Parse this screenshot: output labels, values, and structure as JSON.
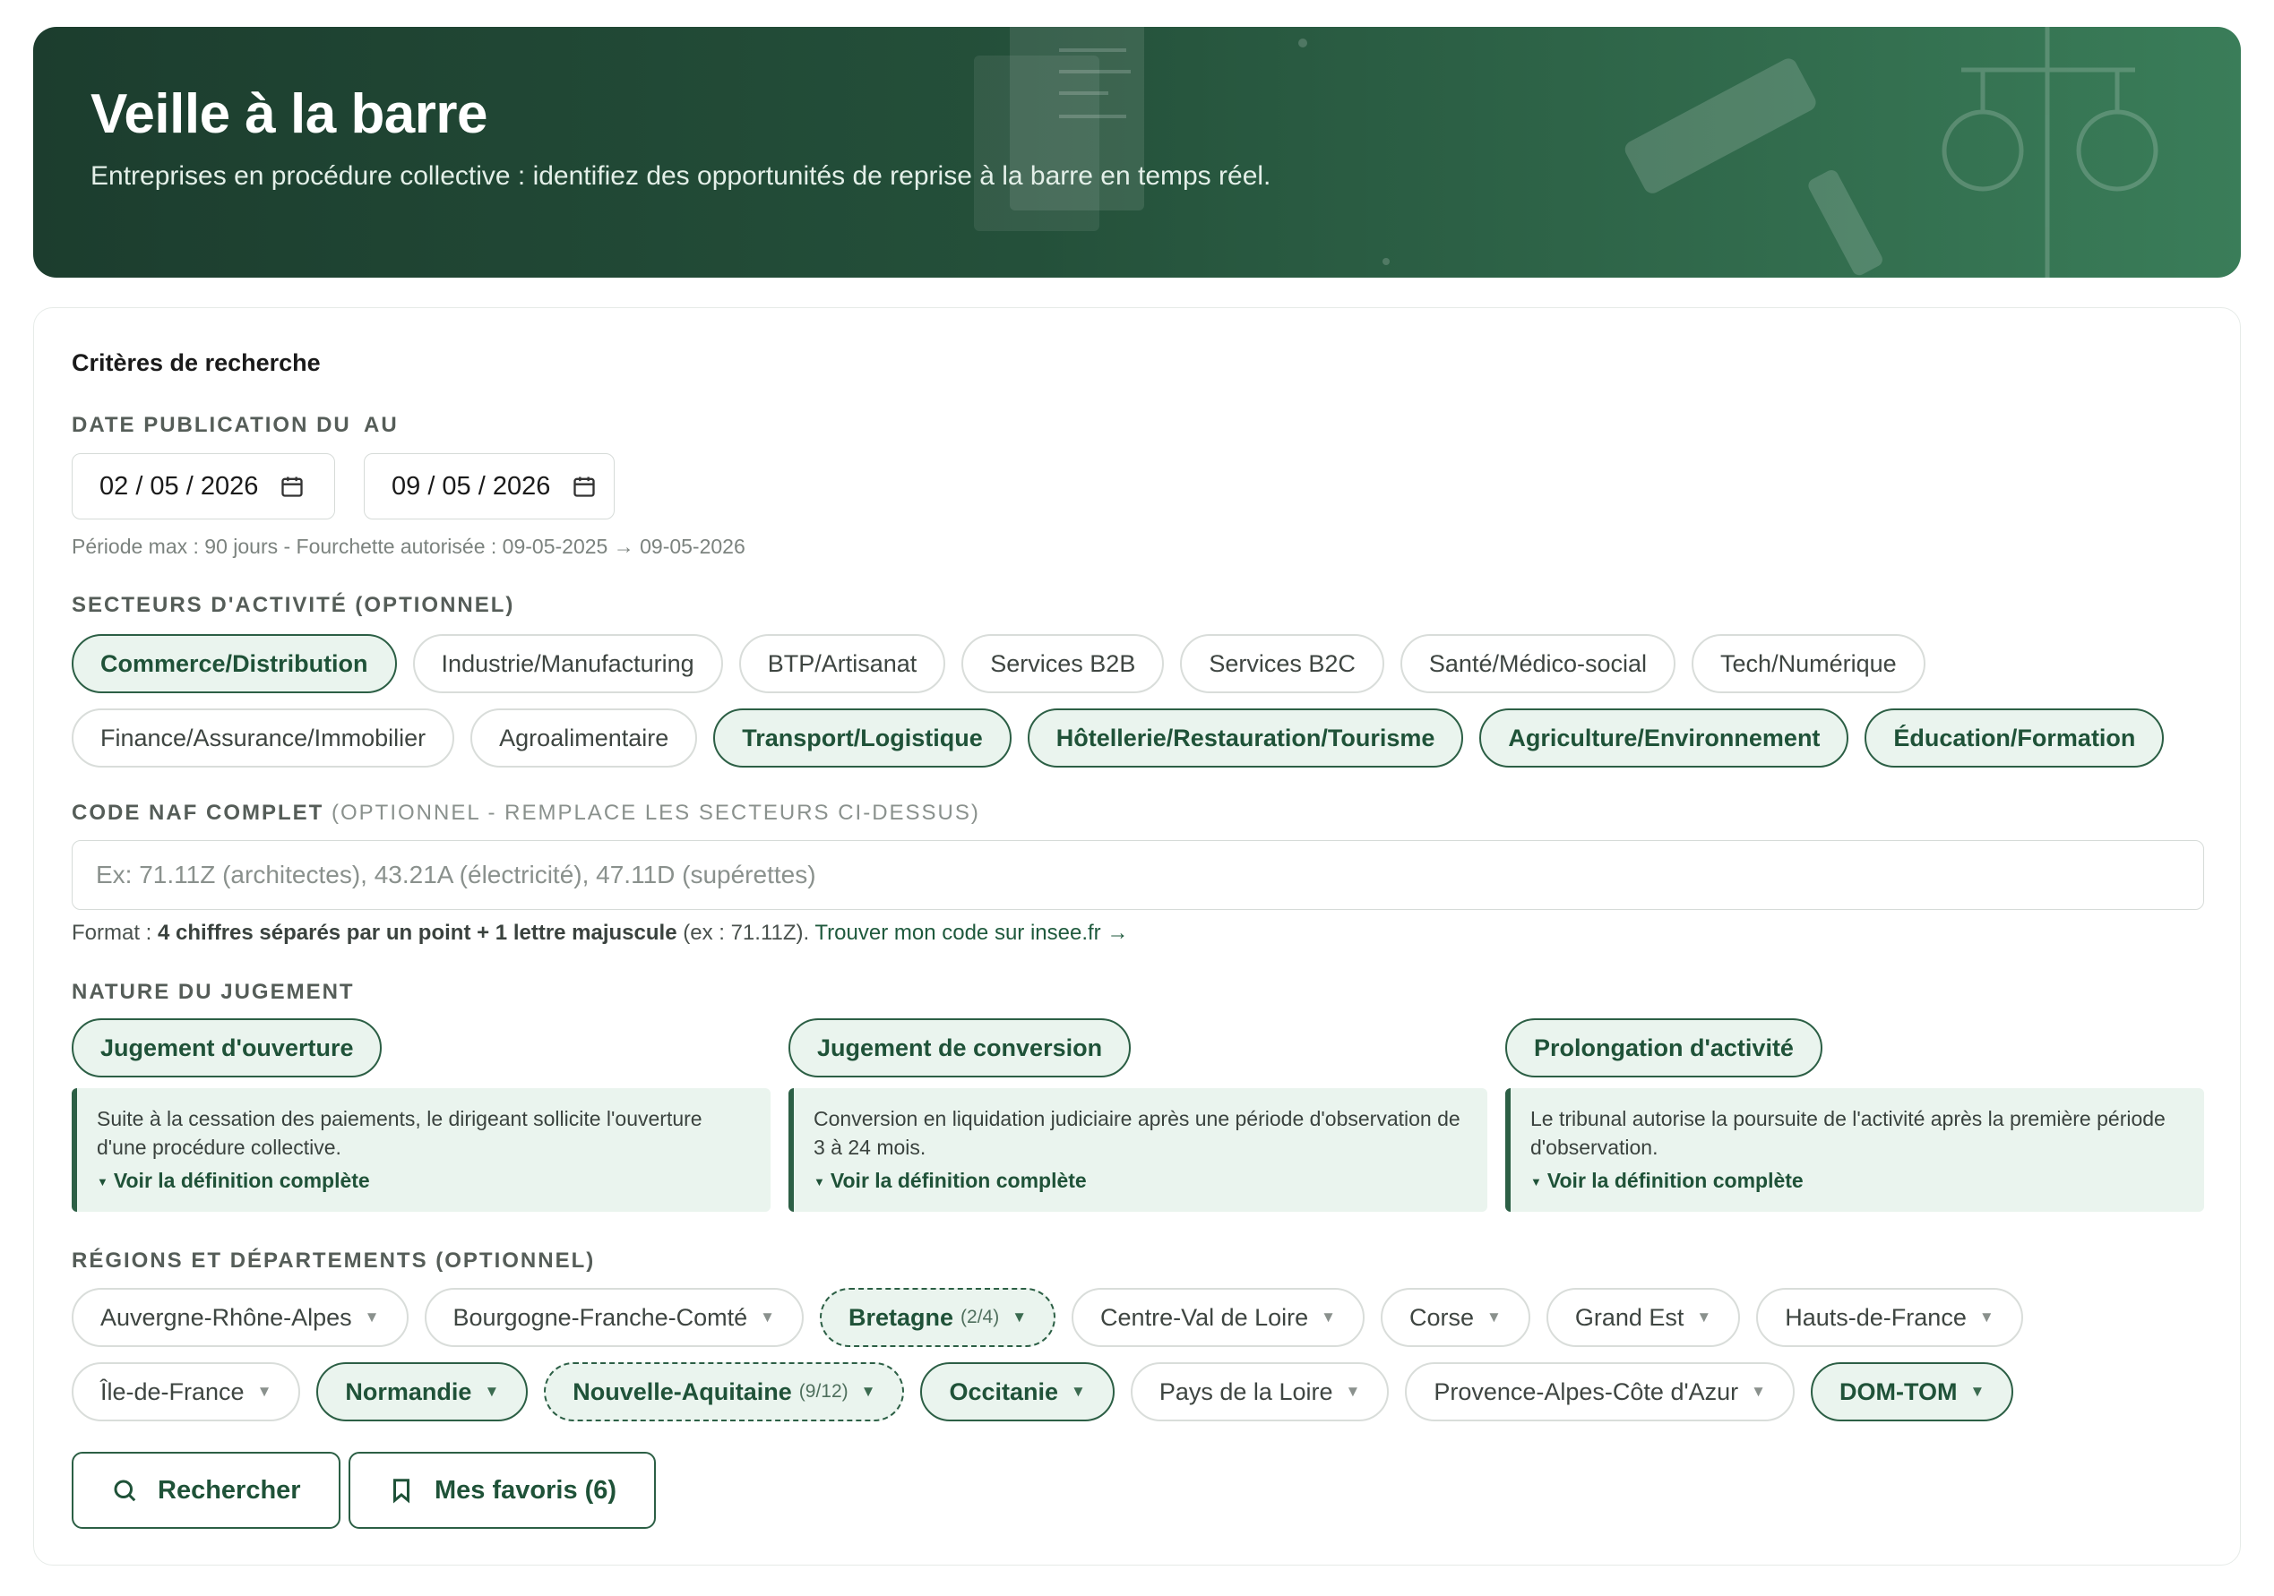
{
  "header": {
    "title": "Veille à la barre",
    "subtitle": "Entreprises en procédure collective : identifiez des opportunités de reprise à la barre en temps réel."
  },
  "search": {
    "section_title": "Critères de recherche",
    "date_from_label": "DATE PUBLICATION DU",
    "date_to_label": "AU",
    "date_from_value": "02 / 05 / 2026",
    "date_to_value": "09 / 05 / 2026",
    "period_hint": "Période max : 90 jours - Fourchette autorisée : 09-05-2025 → 09-05-2026",
    "sectors_label": "SECTEURS D'ACTIVITÉ (OPTIONNEL)",
    "sectors": [
      {
        "label": "Commerce/Distribution",
        "selected": true
      },
      {
        "label": "Industrie/Manufacturing",
        "selected": false
      },
      {
        "label": "BTP/Artisanat",
        "selected": false
      },
      {
        "label": "Services B2B",
        "selected": false
      },
      {
        "label": "Services B2C",
        "selected": false
      },
      {
        "label": "Santé/Médico-social",
        "selected": false
      },
      {
        "label": "Tech/Numérique",
        "selected": false
      },
      {
        "label": "Finance/Assurance/Immobilier",
        "selected": false
      },
      {
        "label": "Agroalimentaire",
        "selected": false
      },
      {
        "label": "Transport/Logistique",
        "selected": true
      },
      {
        "label": "Hôtellerie/Restauration/Tourisme",
        "selected": true
      },
      {
        "label": "Agriculture/Environnement",
        "selected": true
      },
      {
        "label": "Éducation/Formation",
        "selected": true
      }
    ],
    "naf_label": "CODE NAF COMPLET",
    "naf_label_muted": "(OPTIONNEL - REMPLACE LES SECTEURS CI-DESSUS)",
    "naf_placeholder": "Ex: 71.11Z (architectes), 43.21A (électricité), 47.11D (supérettes)",
    "naf_value": "",
    "format_prefix": "Format : ",
    "format_bold": "4 chiffres séparés par un point + 1 lettre majuscule",
    "format_example": " (ex : 71.11Z). ",
    "format_link": "Trouver mon code sur insee.fr →",
    "judgment_label": "NATURE DU JUGEMENT",
    "judgments": [
      {
        "label": "Jugement d'ouverture",
        "desc": "Suite à la cessation des paiements, le dirigeant sollicite l'ouverture d'une procédure collective.",
        "more": "Voir la définition complète"
      },
      {
        "label": "Jugement de conversion",
        "desc": "Conversion en liquidation judiciaire après une période d'observation de 3 à 24 mois.",
        "more": "Voir la définition complète"
      },
      {
        "label": "Prolongation d'activité",
        "desc": "Le tribunal autorise la poursuite de l'activité après la première période d'observation.",
        "more": "Voir la définition complète"
      }
    ],
    "regions_label": "RÉGIONS ET DÉPARTEMENTS (OPTIONNEL)",
    "regions": [
      {
        "label": "Auvergne-Rhône-Alpes",
        "state": "off",
        "count": ""
      },
      {
        "label": "Bourgogne-Franche-Comté",
        "state": "off",
        "count": ""
      },
      {
        "label": "Bretagne",
        "state": "partial",
        "count": "(2/4)"
      },
      {
        "label": "Centre-Val de Loire",
        "state": "off",
        "count": ""
      },
      {
        "label": "Corse",
        "state": "off",
        "count": ""
      },
      {
        "label": "Grand Est",
        "state": "off",
        "count": ""
      },
      {
        "label": "Hauts-de-France",
        "state": "off",
        "count": ""
      },
      {
        "label": "Île-de-France",
        "state": "off",
        "count": ""
      },
      {
        "label": "Normandie",
        "state": "on",
        "count": ""
      },
      {
        "label": "Nouvelle-Aquitaine",
        "state": "partial",
        "count": "(9/12)"
      },
      {
        "label": "Occitanie",
        "state": "on",
        "count": ""
      },
      {
        "label": "Pays de la Loire",
        "state": "off",
        "count": ""
      },
      {
        "label": "Provence-Alpes-Côte d'Azur",
        "state": "off",
        "count": ""
      },
      {
        "label": "DOM-TOM",
        "state": "on",
        "count": ""
      }
    ],
    "search_button": "Rechercher",
    "favorites_button": "Mes favoris (6)"
  },
  "colors": {
    "accent": "#2c5f45",
    "accent_bg": "#eaf4ee",
    "header_dark": "#1c3d2e",
    "header_light": "#3a7d59"
  },
  "icons": {
    "date": "calendar-icon",
    "caret": "caret-down-icon",
    "search": "search-icon",
    "favorites": "bookmark-icon"
  }
}
